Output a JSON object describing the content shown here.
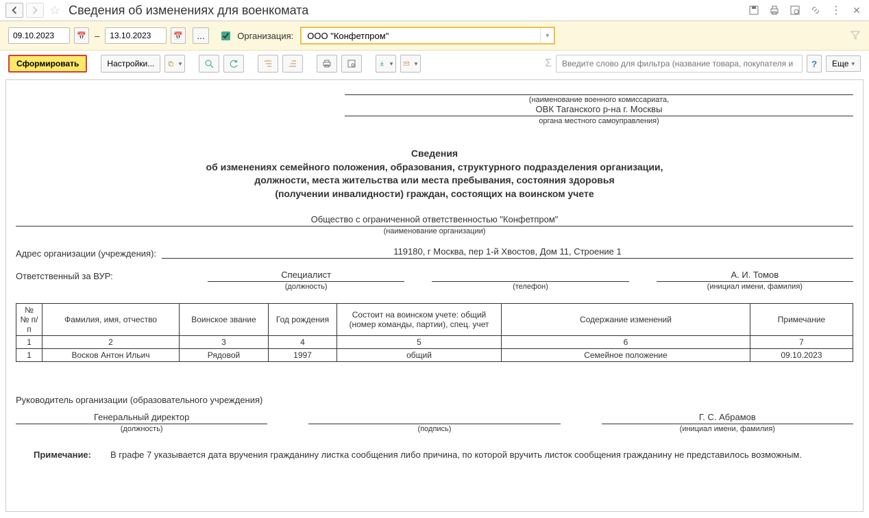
{
  "header": {
    "title": "Сведения об изменениях для военкомата"
  },
  "filters": {
    "date_from": "09.10.2023",
    "date_to": "13.10.2023",
    "org_label": "Организация:",
    "org_value": "ООО \"Конфетпром\""
  },
  "toolbar": {
    "generate": "Сформировать",
    "settings": "Настройки...",
    "filter_placeholder": "Введите слово для фильтра (название товара, покупателя и ...",
    "more": "Еще"
  },
  "report": {
    "comm_name_caption": "(наименование военного комиссариата,",
    "comm_name": "ОВК Таганского р-на г. Москвы",
    "local_gov_caption": "органа местного самоуправления)",
    "title1": "Сведения",
    "title2": "об изменениях семейного положения, образования, структурного подразделения организации,",
    "title3": "должности, места жительства или места пребывания, состояния здоровья",
    "title4": "(получении инвалидности) граждан, состоящих на воинском учете",
    "org_name": "Общество с ограниченной ответственностью \"Конфетпром\"",
    "org_name_caption": "(наименование организации)",
    "address_label": "Адрес организации (учреждения):",
    "address_value": "119180, г Москва, пер 1-й Хвостов, Дом 11, Строение 1",
    "responsible_label": "Ответственный за ВУР:",
    "responsible_position": "Специалист",
    "position_caption": "(должность)",
    "phone_caption": "(телефон)",
    "initials_caption": "(инициал имени, фамилия)",
    "responsible_name": "А. И. Томов",
    "table": {
      "headers": [
        "№ № п/п",
        "Фамилия, имя, отчество",
        "Воинское звание",
        "Год рождения",
        "Состоит на воинском учете: общий (номер команды, партии), спец. учет",
        "Содержание изменений",
        "Примечание"
      ],
      "numrow": [
        "1",
        "2",
        "3",
        "4",
        "5",
        "6",
        "7"
      ],
      "rows": [
        [
          "1",
          "Восков Антон Ильич",
          "Рядовой",
          "1997",
          "общий",
          "Семейное положение",
          "09.10.2023"
        ]
      ]
    },
    "leader_label": "Руководитель организации (образовательного учреждения)",
    "leader_position": "Генеральный директор",
    "signature_caption": "(подпись)",
    "leader_name": "Г. С. Абрамов",
    "note_label": "Примечание:",
    "note_text": "В графе 7 указывается дата вручения гражданину листка сообщения либо причина, по которой вручить листок сообщения гражданину не представилось возможным."
  }
}
